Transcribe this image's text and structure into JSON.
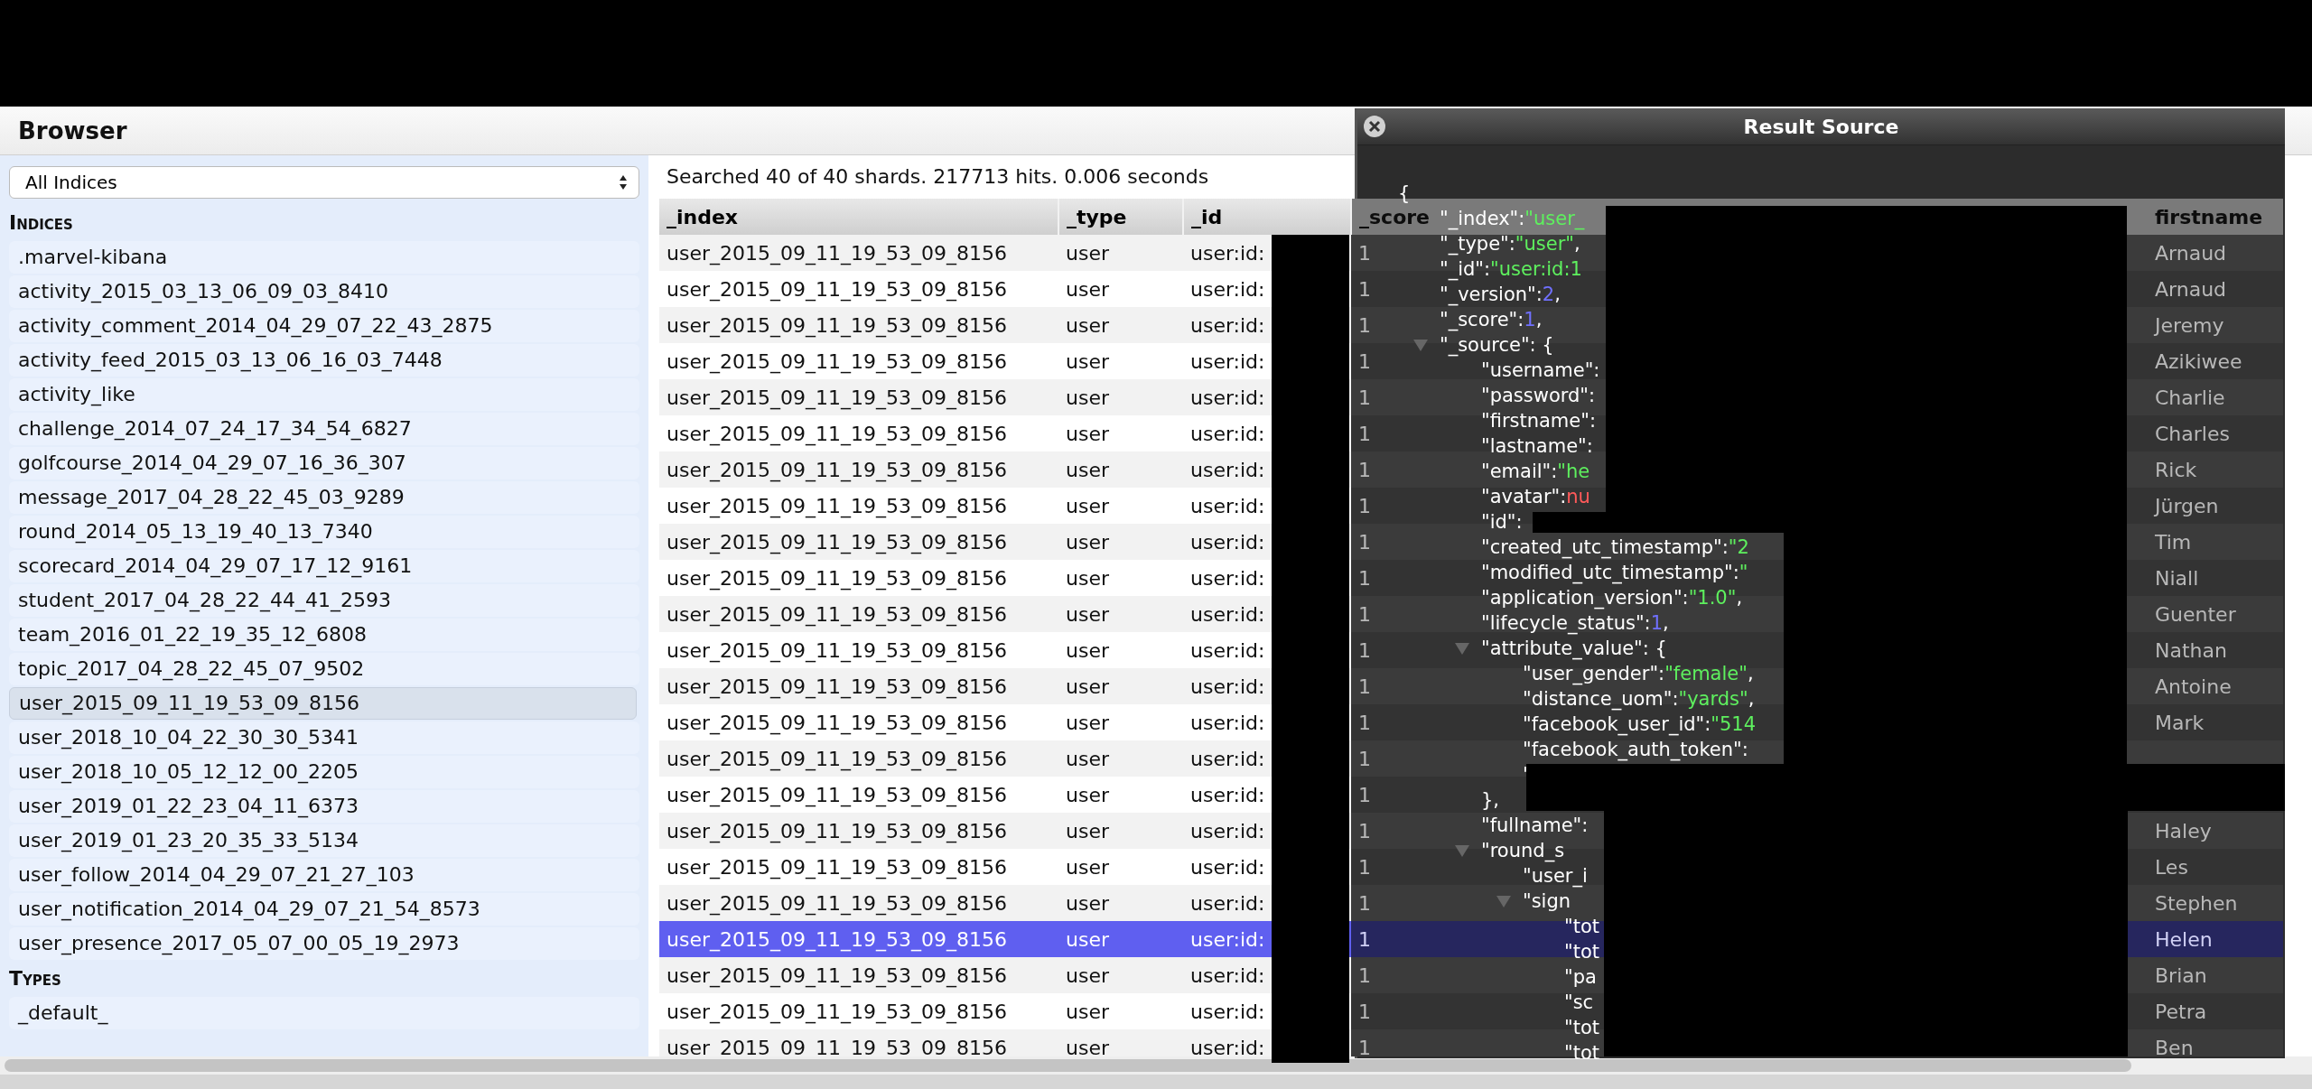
{
  "header": {
    "title": "Browser"
  },
  "sidebar": {
    "index_select": {
      "value": "All Indices"
    },
    "sections": [
      {
        "heading": "Indices",
        "items": [
          {
            "label": ".marvel-kibana",
            "selected": false
          },
          {
            "label": "activity_2015_03_13_06_09_03_8410",
            "selected": false
          },
          {
            "label": "activity_comment_2014_04_29_07_22_43_2875",
            "selected": false
          },
          {
            "label": "activity_feed_2015_03_13_06_16_03_7448",
            "selected": false
          },
          {
            "label": "activity_like",
            "selected": false
          },
          {
            "label": "challenge_2014_07_24_17_34_54_6827",
            "selected": false
          },
          {
            "label": "golfcourse_2014_04_29_07_16_36_307",
            "selected": false
          },
          {
            "label": "message_2017_04_28_22_45_03_9289",
            "selected": false
          },
          {
            "label": "round_2014_05_13_19_40_13_7340",
            "selected": false
          },
          {
            "label": "scorecard_2014_04_29_07_17_12_9161",
            "selected": false
          },
          {
            "label": "student_2017_04_28_22_44_41_2593",
            "selected": false
          },
          {
            "label": "team_2016_01_22_19_35_12_6808",
            "selected": false
          },
          {
            "label": "topic_2017_04_28_22_45_07_9502",
            "selected": false
          },
          {
            "label": "user_2015_09_11_19_53_09_8156",
            "selected": true
          },
          {
            "label": "user_2018_10_04_22_30_30_5341",
            "selected": false
          },
          {
            "label": "user_2018_10_05_12_12_00_2205",
            "selected": false
          },
          {
            "label": "user_2019_01_22_23_04_11_6373",
            "selected": false
          },
          {
            "label": "user_2019_01_23_20_35_33_5134",
            "selected": false
          },
          {
            "label": "user_follow_2014_04_29_07_21_27_103",
            "selected": false
          },
          {
            "label": "user_notification_2014_04_29_07_21_54_8573",
            "selected": false
          },
          {
            "label": "user_presence_2017_05_07_00_05_19_2973",
            "selected": false
          }
        ]
      },
      {
        "heading": "Types",
        "items": [
          {
            "label": "_default_",
            "selected": false
          }
        ]
      }
    ]
  },
  "results": {
    "summary": "Searched 40 of 40 shards. 217713 hits. 0.006 seconds",
    "table": {
      "columns": [
        "_index",
        "_type",
        "_id",
        "_score",
        "firstname"
      ],
      "rows": [
        {
          "index": "user_2015_09_11_19_53_09_8156",
          "type": "user",
          "id": "user:id:",
          "score": "1",
          "firstname": "Arnaud",
          "selected": false
        },
        {
          "index": "user_2015_09_11_19_53_09_8156",
          "type": "user",
          "id": "user:id:",
          "score": "1",
          "firstname": "Arnaud",
          "selected": false
        },
        {
          "index": "user_2015_09_11_19_53_09_8156",
          "type": "user",
          "id": "user:id:",
          "score": "1",
          "firstname": "Jeremy",
          "selected": false
        },
        {
          "index": "user_2015_09_11_19_53_09_8156",
          "type": "user",
          "id": "user:id:",
          "score": "1",
          "firstname": "Azikiwee",
          "selected": false
        },
        {
          "index": "user_2015_09_11_19_53_09_8156",
          "type": "user",
          "id": "user:id:",
          "score": "1",
          "firstname": "Charlie",
          "selected": false
        },
        {
          "index": "user_2015_09_11_19_53_09_8156",
          "type": "user",
          "id": "user:id:",
          "score": "1",
          "firstname": "Charles",
          "selected": false
        },
        {
          "index": "user_2015_09_11_19_53_09_8156",
          "type": "user",
          "id": "user:id:",
          "score": "1",
          "firstname": "Rick",
          "selected": false
        },
        {
          "index": "user_2015_09_11_19_53_09_8156",
          "type": "user",
          "id": "user:id:",
          "score": "1",
          "firstname": "Jürgen",
          "selected": false
        },
        {
          "index": "user_2015_09_11_19_53_09_8156",
          "type": "user",
          "id": "user:id:",
          "score": "1",
          "firstname": "Tim",
          "selected": false
        },
        {
          "index": "user_2015_09_11_19_53_09_8156",
          "type": "user",
          "id": "user:id:",
          "score": "1",
          "firstname": "Niall",
          "selected": false
        },
        {
          "index": "user_2015_09_11_19_53_09_8156",
          "type": "user",
          "id": "user:id:",
          "score": "1",
          "firstname": "Guenter",
          "selected": false
        },
        {
          "index": "user_2015_09_11_19_53_09_8156",
          "type": "user",
          "id": "user:id:",
          "score": "1",
          "firstname": "Nathan",
          "selected": false
        },
        {
          "index": "user_2015_09_11_19_53_09_8156",
          "type": "user",
          "id": "user:id:",
          "score": "1",
          "firstname": "Antoine",
          "selected": false
        },
        {
          "index": "user_2015_09_11_19_53_09_8156",
          "type": "user",
          "id": "user:id:",
          "score": "1",
          "firstname": "Mark",
          "selected": false
        },
        {
          "index": "user_2015_09_11_19_53_09_8156",
          "type": "user",
          "id": "user:id:",
          "score": "1",
          "selected": false
        },
        {
          "index": "user_2015_09_11_19_53_09_8156",
          "type": "user",
          "id": "user:id:",
          "score": "1",
          "selected": false
        },
        {
          "index": "user_2015_09_11_19_53_09_8156",
          "type": "user",
          "id": "user:id:",
          "score": "1",
          "firstname": "Haley",
          "selected": false
        },
        {
          "index": "user_2015_09_11_19_53_09_8156",
          "type": "user",
          "id": "user:id:",
          "score": "1",
          "firstname": "Les",
          "selected": false
        },
        {
          "index": "user_2015_09_11_19_53_09_8156",
          "type": "user",
          "id": "user:id:",
          "score": "1",
          "firstname": "Stephen",
          "selected": false
        },
        {
          "index": "user_2015_09_11_19_53_09_8156",
          "type": "user",
          "id": "user:id:",
          "score": "1",
          "firstname": "Helen",
          "selected": true
        },
        {
          "index": "user_2015_09_11_19_53_09_8156",
          "type": "user",
          "id": "user:id:",
          "score": "1",
          "firstname": "Brian",
          "selected": false
        },
        {
          "index": "user_2015_09_11_19_53_09_8156",
          "type": "user",
          "id": "user:id:",
          "score": "1",
          "firstname": "Petra",
          "selected": false
        },
        {
          "index": "user_2015_09_11_19_53_09_8156",
          "type": "user",
          "id": "user:id:",
          "score": "1",
          "firstname": "Ben",
          "selected": false
        }
      ]
    }
  },
  "dialog": {
    "title": "Result Source",
    "source": [
      {
        "key": "{",
        "children": [
          {
            "key": "\"_index\":",
            "value": "\"user_",
            "kind": "string"
          },
          {
            "key": "\"_type\":",
            "value": "\"user\"",
            "kind": "string",
            "suffix": ","
          },
          {
            "key": "\"_id\":",
            "value": "\"user:id:1",
            "kind": "string"
          },
          {
            "key": "\"_version\":",
            "value": "2",
            "kind": "number",
            "suffix": ","
          },
          {
            "key": "\"_score\":",
            "value": "1",
            "kind": "number",
            "suffix": ","
          },
          {
            "key": "\"_source\": {",
            "expanded": true,
            "children": [
              {
                "key": "\"username\":"
              },
              {
                "key": "\"password\":"
              },
              {
                "key": "\"firstname\":"
              },
              {
                "key": "\"lastname\":"
              },
              {
                "key": "\"email\":",
                "value": "\"he",
                "kind": "string"
              },
              {
                "key": "\"avatar\":",
                "value": "nu",
                "kind": "null"
              },
              {
                "key": "\"id\":"
              },
              {
                "key": "\"created_utc_timestamp\":",
                "value": "\"2",
                "kind": "string"
              },
              {
                "key": "\"modified_utc_timestamp\":",
                "value": "\"",
                "kind": "string"
              },
              {
                "key": "\"application_version\":",
                "value": "\"1.0\"",
                "kind": "string",
                "suffix": ","
              },
              {
                "key": "\"lifecycle_status\":",
                "value": "1",
                "kind": "number",
                "suffix": ","
              },
              {
                "key": "\"attribute_value\": {",
                "expanded": true,
                "children": [
                  {
                    "key": "\"user_gender\":",
                    "value": "\"female\"",
                    "kind": "string",
                    "suffix": ","
                  },
                  {
                    "key": "\"distance_uom\":",
                    "value": "\"yards\"",
                    "kind": "string",
                    "suffix": ","
                  },
                  {
                    "key": "\"facebook_user_id\":",
                    "value": "\"514",
                    "kind": "string"
                  },
                  {
                    "key": "\"facebook_auth_token\":"
                  },
                  {
                    "key": "\""
                  }
                ]
              },
              {
                "key": "},"
              },
              {
                "key": "\"fullname\":"
              },
              {
                "key": "\"round_s",
                "expanded": true,
                "children": [
                  {
                    "key": "\"user_i"
                  },
                  {
                    "key": "\"sign",
                    "expanded": true,
                    "children": [
                      {
                        "key": "\"tot"
                      },
                      {
                        "key": "\"tot"
                      },
                      {
                        "key": "\"pa"
                      },
                      {
                        "key": "\"sc"
                      },
                      {
                        "key": "\"tot"
                      },
                      {
                        "key": "\"tot"
                      }
                    ]
                  }
                ]
              }
            ]
          }
        ]
      }
    ]
  }
}
